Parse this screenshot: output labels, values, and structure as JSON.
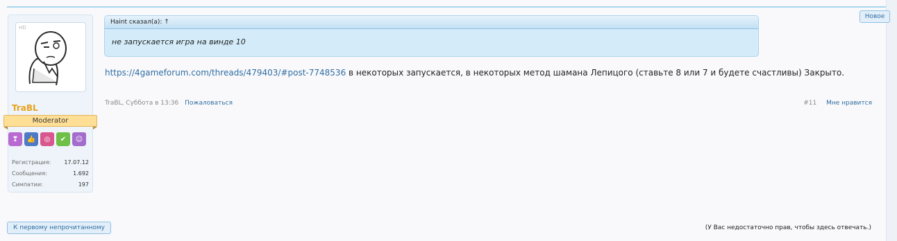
{
  "post": {
    "new_label": "Новое",
    "quote": {
      "header": "Haint сказал(а): ↑",
      "text": "не запускается игра на винде 10"
    },
    "message": {
      "link_text": "https://4gameforum.com/threads/479403/#post-7748536",
      "text": " в некоторых запускается, в некоторых метод шамана Лепицого (ставьте 8 или 7 и будете счастливы) Закрыто."
    },
    "meta": {
      "author_time": "TraBL, Суббота в 13:36",
      "report": "Пожаловаться",
      "post_number": "#11",
      "like": "Мне нравится"
    }
  },
  "user": {
    "avatar_tag": "HD",
    "username": "TraBL",
    "role": "Moderator",
    "badges": [
      {
        "icon": "hearts-icon",
        "color": "#b96ad1"
      },
      {
        "icon": "thumbs-up-icon",
        "color": "#4d79c7"
      },
      {
        "icon": "glasses-icon",
        "color": "#d9578e"
      },
      {
        "icon": "check-icon",
        "color": "#6fbf48"
      },
      {
        "icon": "person-icon",
        "color": "#a46ccd"
      }
    ],
    "stats": [
      {
        "label": "Регистрация:",
        "value": "17.07.12"
      },
      {
        "label": "Сообщения:",
        "value": "1.692"
      },
      {
        "label": "Симпатии:",
        "value": "197"
      }
    ]
  },
  "footer": {
    "unread_button": "К первому непрочитанному",
    "permission_note": "(У Вас недостаточно прав, чтобы здесь отвечать.)"
  }
}
